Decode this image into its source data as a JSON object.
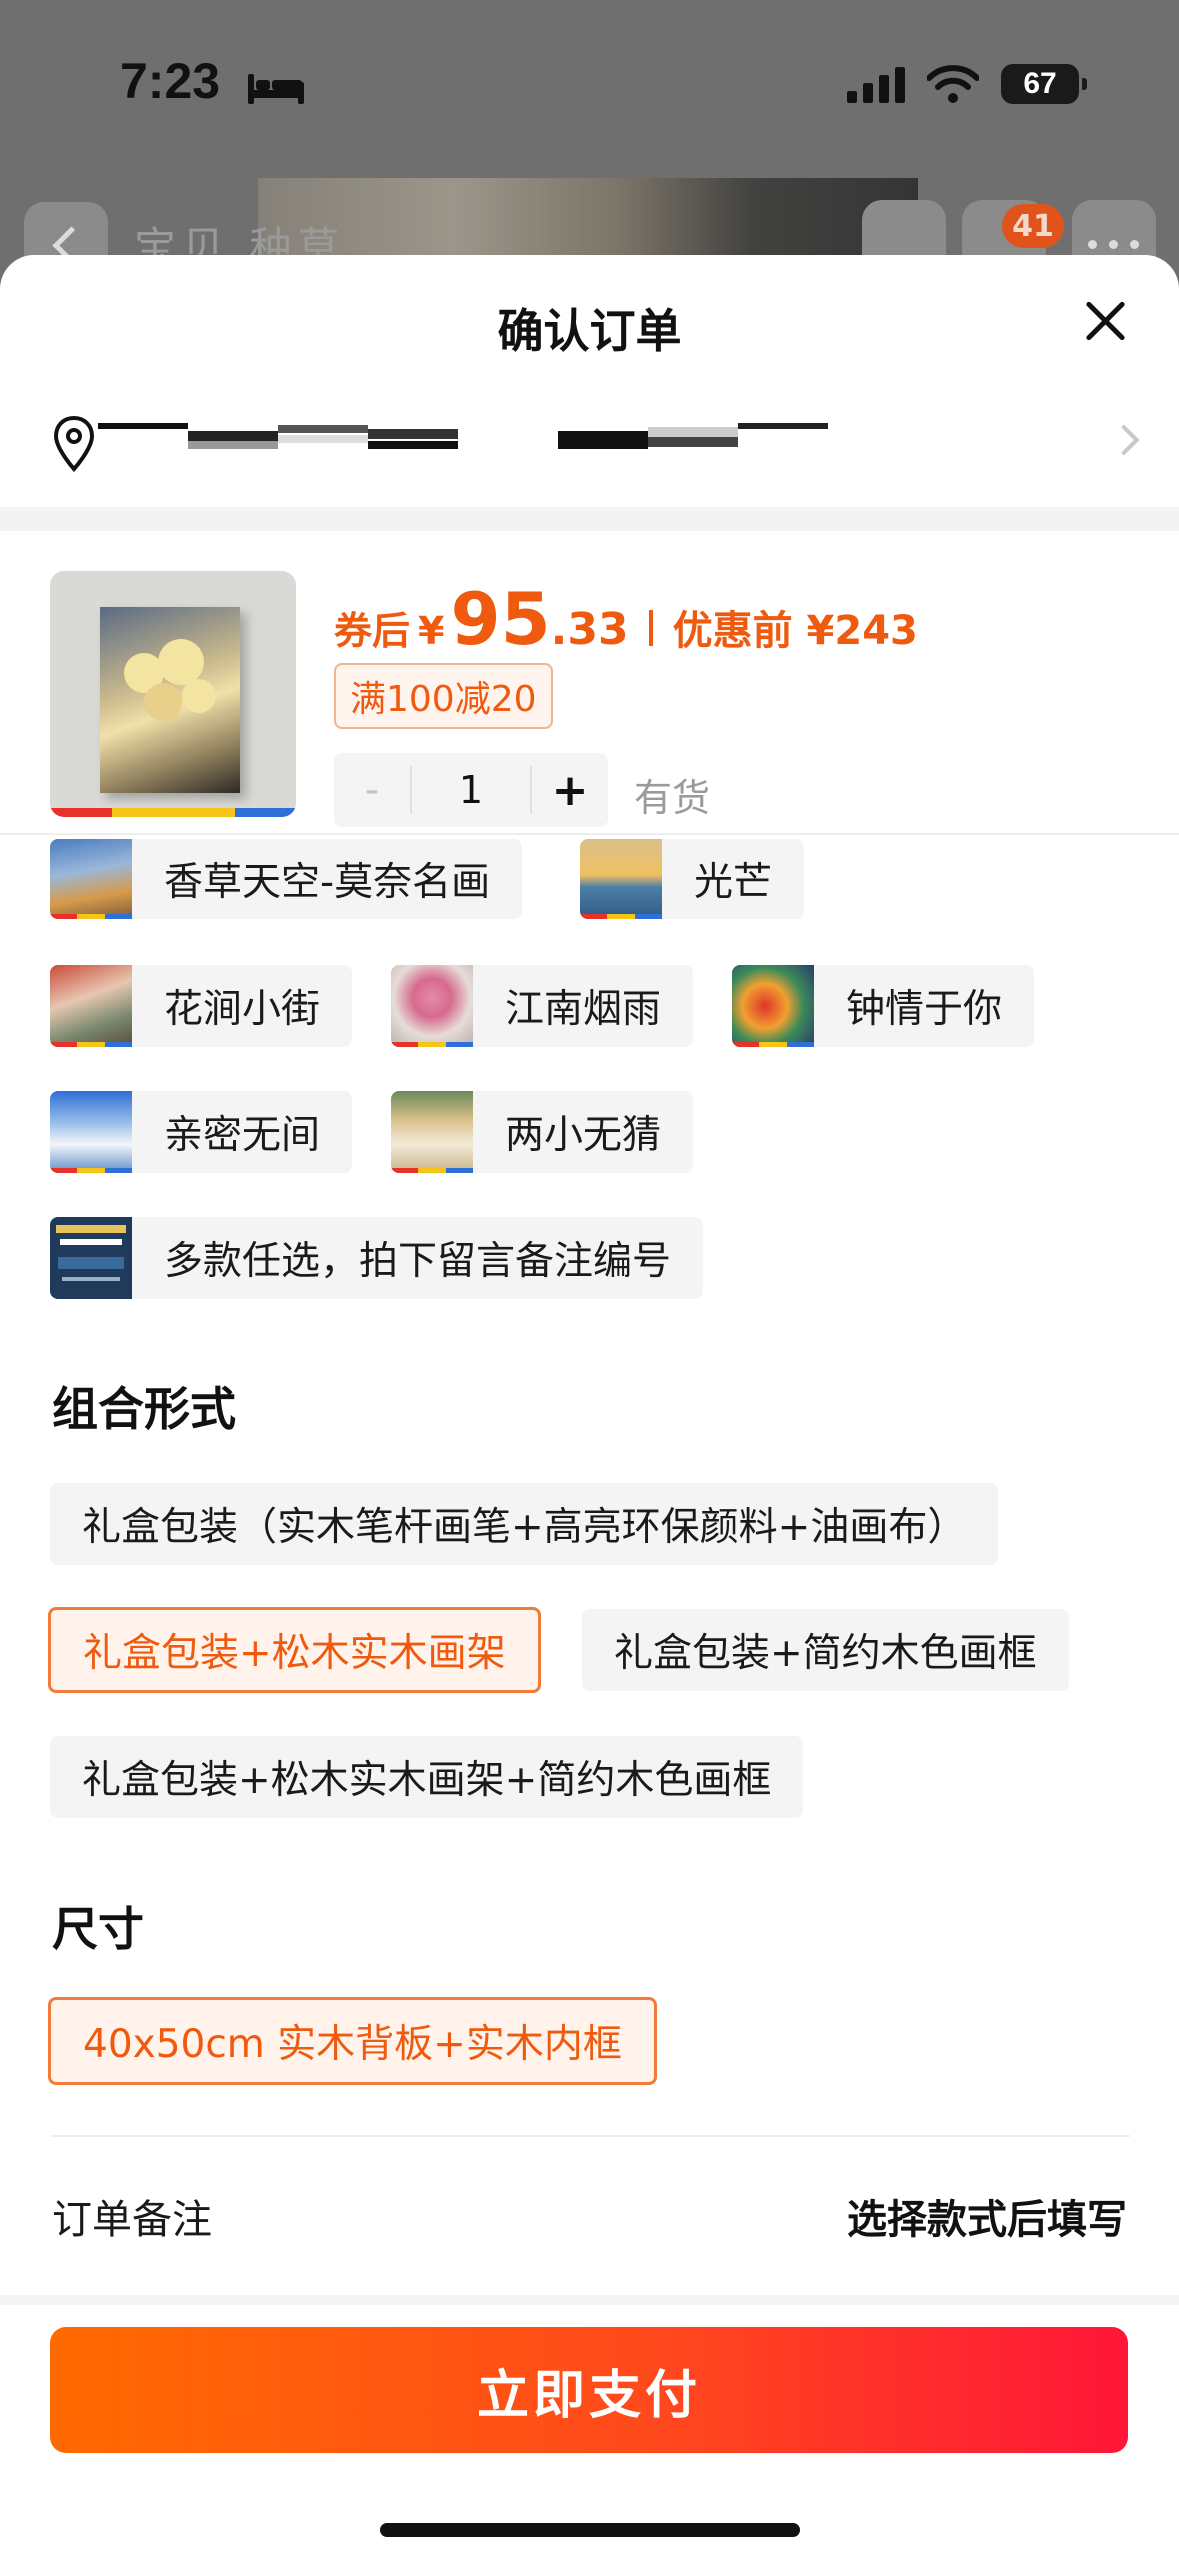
{
  "status_bar": {
    "time": "7:23",
    "battery": "67"
  },
  "background_nav": {
    "tabs_text": "宝贝 种草",
    "cart_count": "41"
  },
  "sheet": {
    "title": "确认订单"
  },
  "product": {
    "price_prefix": "券后",
    "currency": "¥",
    "price_integer": "95",
    "price_decimal": ".33",
    "original_price_text": "优惠前 ¥243",
    "coupon": "满100减20",
    "quantity": "1",
    "minus_label": "-",
    "plus_label": "+",
    "stock_status": "有货"
  },
  "styles": [
    {
      "label": "香草天空-莫奈名画"
    },
    {
      "label": "光芒"
    },
    {
      "label": "花涧小街"
    },
    {
      "label": "江南烟雨"
    },
    {
      "label": "钟情于你"
    },
    {
      "label": "亲密无间"
    },
    {
      "label": "两小无猜"
    },
    {
      "label": "多款任选，拍下留言备注编号"
    }
  ],
  "combo": {
    "title": "组合形式",
    "options": [
      {
        "label": "礼盒包装（实木笔杆画笔+高亮环保颜料+油画布）",
        "selected": false
      },
      {
        "label": "礼盒包装+松木实木画架",
        "selected": true
      },
      {
        "label": "礼盒包装+简约木色画框",
        "selected": false
      },
      {
        "label": "礼盒包装+松木实木画架+简约木色画框",
        "selected": false
      }
    ]
  },
  "size": {
    "title": "尺寸",
    "options": [
      {
        "label": "40x50cm 实木背板+实木内框",
        "selected": true
      }
    ]
  },
  "order_note": {
    "label": "订单备注",
    "hint": "选择款式后填写"
  },
  "pay_button": "立即支付",
  "colors": {
    "accent": "#ef5a0f",
    "pay_start": "#ff6a00",
    "pay_end": "#ff1638",
    "stripe": [
      "#e63228",
      "#f5c518",
      "#2f6fd8"
    ]
  }
}
